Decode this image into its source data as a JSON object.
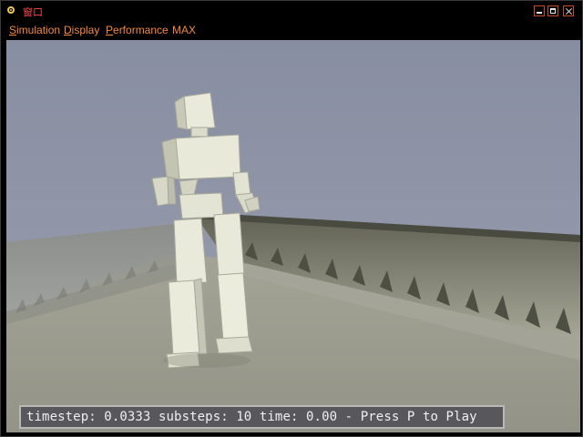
{
  "window": {
    "title": "窗口",
    "icon": "app-icon",
    "controls": [
      "minimize-icon",
      "maximize-icon",
      "close-icon"
    ]
  },
  "menu": {
    "simulation": {
      "accel": "S",
      "rest": "imulation"
    },
    "display": {
      "accel": "D",
      "rest": "isplay"
    },
    "performance": {
      "accel": "P",
      "rest": "erformance"
    },
    "max": {
      "label": "MAX"
    }
  },
  "status": {
    "text": "timestep: 0.0333 substeps: 10 time: 0.00 - Press P to Play"
  },
  "colors": {
    "sky": "#8c93a6",
    "floor": "#9c9c90",
    "figure": "#e6e6d6",
    "menu_text": "#f58a3c",
    "title_text": "#ff4a4a"
  }
}
